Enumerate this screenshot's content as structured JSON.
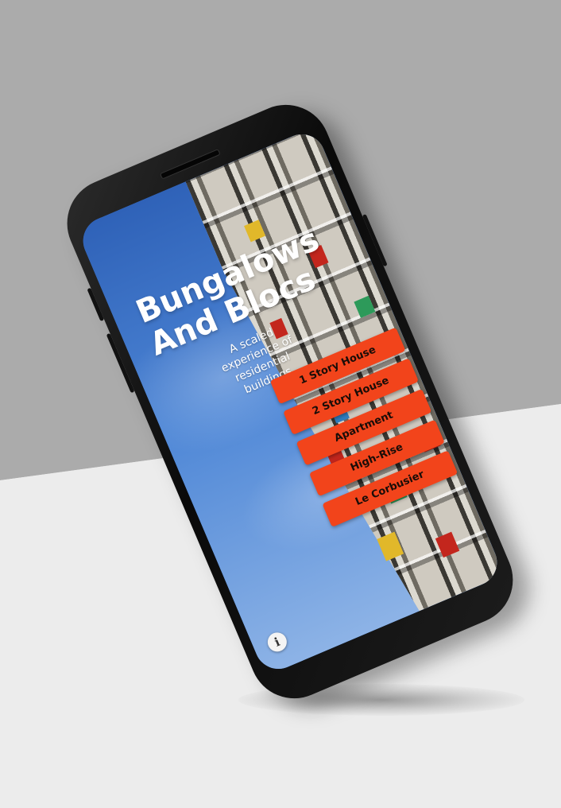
{
  "app": {
    "title_line1": "Bungalows",
    "title_line2": "And Blocs",
    "subtitle": "A scaled experience of residential buildings"
  },
  "menu": {
    "items": [
      {
        "label": "1 Story House"
      },
      {
        "label": "2 Story House"
      },
      {
        "label": "Apartment"
      },
      {
        "label": "High-Rise"
      },
      {
        "label": "Le Corbusier"
      }
    ]
  },
  "info_button": {
    "icon": "info-icon",
    "glyph": "i"
  },
  "colors": {
    "button": "#f2441b",
    "sky": "#3d74c9",
    "backdrop_top": "#ababab",
    "backdrop_bottom": "#ececec"
  }
}
